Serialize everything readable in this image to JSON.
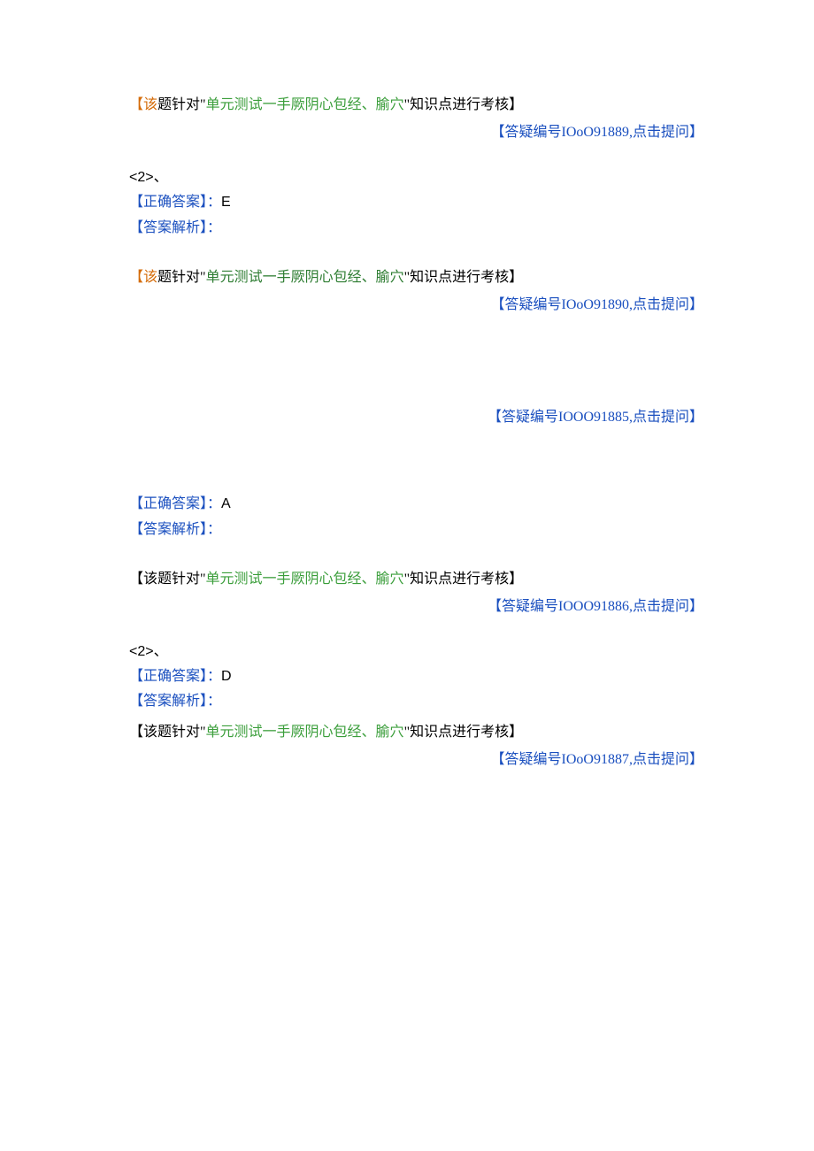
{
  "s1": {
    "note_prefix": "【该",
    "note_mid1": "题针对\"",
    "note_topic": "单元测试一手厥阴心包经、腧穴",
    "note_suffix": "\"知识点进行考核】",
    "qa_link": "【答疑编号IOoO91889,点击提问】"
  },
  "s2": {
    "heading": "<2>、",
    "ans_label": "【正确答案】：",
    "ans_value": "E",
    "expl_label": "【答案解析】：",
    "note_prefix": "【该",
    "note_mid1": "题针对\"",
    "note_topic": "单元测试一手厥阴心包经、腧穴",
    "note_suffix": "\"知识点进行考核】",
    "qa_link": "【答疑编号IOoO91890,点击提问】"
  },
  "s3": {
    "qa_link": "【答疑编号IOOO91885,点击提问】"
  },
  "s4": {
    "ans_label": "【正确答案】：",
    "ans_value": "A",
    "expl_label": "【答案解析】：",
    "note_prefix": "【该题针对\"",
    "note_topic": "单元测试一手厥阴心包经、腧穴",
    "note_suffix": "\"知识点进行考核】",
    "qa_link": "【答疑编号IOOO91886,点击提问】"
  },
  "s5": {
    "heading": "<2>、",
    "ans_label": "【正确答案】：",
    "ans_value": "D",
    "expl_label": "【答案解析】：",
    "note_prefix": "【该题针对\"",
    "note_topic": "单元测试一手厥阴心包经、腧穴",
    "note_suffix": "\"知识点进行考核】",
    "qa_link": "【答疑编号IOoO91887,点击提问】"
  }
}
